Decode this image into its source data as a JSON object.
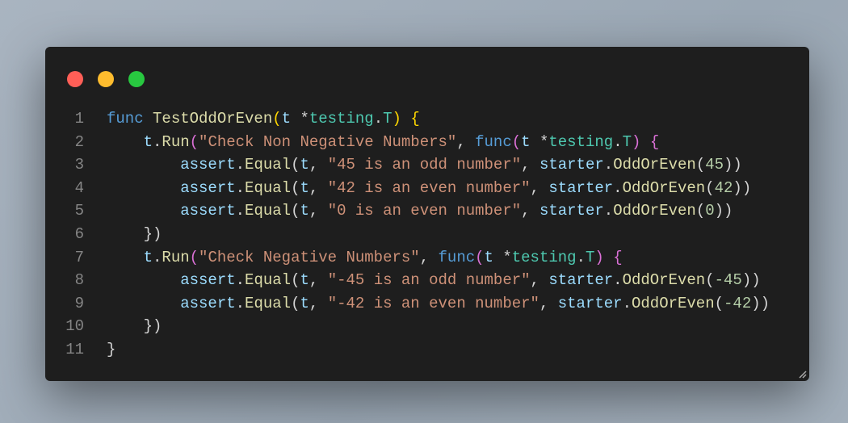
{
  "window": {
    "controls": [
      {
        "name": "close",
        "color": "#ff5f57"
      },
      {
        "name": "minimize",
        "color": "#febc2e"
      },
      {
        "name": "maximize",
        "color": "#28c840"
      }
    ]
  },
  "code": {
    "lines": [
      [
        [
          "func",
          "kw"
        ],
        [
          " ",
          "punc"
        ],
        [
          "TestOddOrEven",
          "fn"
        ],
        [
          "(",
          "brk"
        ],
        [
          "t",
          "var"
        ],
        [
          " *",
          "punc"
        ],
        [
          "testing",
          "type"
        ],
        [
          ".",
          "punc"
        ],
        [
          "T",
          "type"
        ],
        [
          ")",
          "brk"
        ],
        [
          " ",
          "punc"
        ],
        [
          "{",
          "brk"
        ]
      ],
      [
        [
          "    ",
          "punc"
        ],
        [
          "t",
          "var"
        ],
        [
          ".",
          "punc"
        ],
        [
          "Run",
          "fn"
        ],
        [
          "(",
          "brk2"
        ],
        [
          "\"Check Non Negative Numbers\"",
          "str"
        ],
        [
          ", ",
          "punc"
        ],
        [
          "func",
          "kw"
        ],
        [
          "(",
          "brk2"
        ],
        [
          "t",
          "var"
        ],
        [
          " *",
          "punc"
        ],
        [
          "testing",
          "type"
        ],
        [
          ".",
          "punc"
        ],
        [
          "T",
          "type"
        ],
        [
          ")",
          "brk2"
        ],
        [
          " ",
          "punc"
        ],
        [
          "{",
          "brk2"
        ]
      ],
      [
        [
          "        ",
          "punc"
        ],
        [
          "assert",
          "var"
        ],
        [
          ".",
          "punc"
        ],
        [
          "Equal",
          "fn"
        ],
        [
          "(",
          "punc"
        ],
        [
          "t",
          "var"
        ],
        [
          ", ",
          "punc"
        ],
        [
          "\"45 is an odd number\"",
          "str"
        ],
        [
          ", ",
          "punc"
        ],
        [
          "starter",
          "var"
        ],
        [
          ".",
          "punc"
        ],
        [
          "OddOrEven",
          "fn"
        ],
        [
          "(",
          "punc"
        ],
        [
          "45",
          "num"
        ],
        [
          "))",
          "punc"
        ]
      ],
      [
        [
          "        ",
          "punc"
        ],
        [
          "assert",
          "var"
        ],
        [
          ".",
          "punc"
        ],
        [
          "Equal",
          "fn"
        ],
        [
          "(",
          "punc"
        ],
        [
          "t",
          "var"
        ],
        [
          ", ",
          "punc"
        ],
        [
          "\"42 is an even number\"",
          "str"
        ],
        [
          ", ",
          "punc"
        ],
        [
          "starter",
          "var"
        ],
        [
          ".",
          "punc"
        ],
        [
          "OddOrEven",
          "fn"
        ],
        [
          "(",
          "punc"
        ],
        [
          "42",
          "num"
        ],
        [
          "))",
          "punc"
        ]
      ],
      [
        [
          "        ",
          "punc"
        ],
        [
          "assert",
          "var"
        ],
        [
          ".",
          "punc"
        ],
        [
          "Equal",
          "fn"
        ],
        [
          "(",
          "punc"
        ],
        [
          "t",
          "var"
        ],
        [
          ", ",
          "punc"
        ],
        [
          "\"0 is an even number\"",
          "str"
        ],
        [
          ", ",
          "punc"
        ],
        [
          "starter",
          "var"
        ],
        [
          ".",
          "punc"
        ],
        [
          "OddOrEven",
          "fn"
        ],
        [
          "(",
          "punc"
        ],
        [
          "0",
          "num"
        ],
        [
          "))",
          "punc"
        ]
      ],
      [
        [
          "    ",
          "punc"
        ],
        [
          "})",
          "punc"
        ]
      ],
      [
        [
          "    ",
          "punc"
        ],
        [
          "t",
          "var"
        ],
        [
          ".",
          "punc"
        ],
        [
          "Run",
          "fn"
        ],
        [
          "(",
          "brk2"
        ],
        [
          "\"Check Negative Numbers\"",
          "str"
        ],
        [
          ", ",
          "punc"
        ],
        [
          "func",
          "kw"
        ],
        [
          "(",
          "brk2"
        ],
        [
          "t",
          "var"
        ],
        [
          " *",
          "punc"
        ],
        [
          "testing",
          "type"
        ],
        [
          ".",
          "punc"
        ],
        [
          "T",
          "type"
        ],
        [
          ")",
          "brk2"
        ],
        [
          " ",
          "punc"
        ],
        [
          "{",
          "brk2"
        ]
      ],
      [
        [
          "        ",
          "punc"
        ],
        [
          "assert",
          "var"
        ],
        [
          ".",
          "punc"
        ],
        [
          "Equal",
          "fn"
        ],
        [
          "(",
          "punc"
        ],
        [
          "t",
          "var"
        ],
        [
          ", ",
          "punc"
        ],
        [
          "\"-45 is an odd number\"",
          "str"
        ],
        [
          ", ",
          "punc"
        ],
        [
          "starter",
          "var"
        ],
        [
          ".",
          "punc"
        ],
        [
          "OddOrEven",
          "fn"
        ],
        [
          "(",
          "punc"
        ],
        [
          "-45",
          "num"
        ],
        [
          "))",
          "punc"
        ]
      ],
      [
        [
          "        ",
          "punc"
        ],
        [
          "assert",
          "var"
        ],
        [
          ".",
          "punc"
        ],
        [
          "Equal",
          "fn"
        ],
        [
          "(",
          "punc"
        ],
        [
          "t",
          "var"
        ],
        [
          ", ",
          "punc"
        ],
        [
          "\"-42 is an even number\"",
          "str"
        ],
        [
          ", ",
          "punc"
        ],
        [
          "starter",
          "var"
        ],
        [
          ".",
          "punc"
        ],
        [
          "OddOrEven",
          "fn"
        ],
        [
          "(",
          "punc"
        ],
        [
          "-42",
          "num"
        ],
        [
          "))",
          "punc"
        ]
      ],
      [
        [
          "    ",
          "punc"
        ],
        [
          "})",
          "punc"
        ]
      ],
      [
        [
          "}",
          "punc"
        ]
      ]
    ]
  }
}
